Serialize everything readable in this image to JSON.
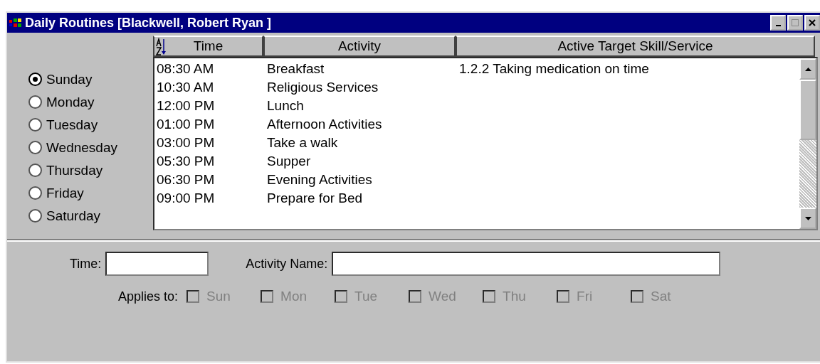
{
  "window": {
    "title": "Daily Routines [Blackwell, Robert Ryan ]"
  },
  "days": [
    {
      "label": "Sunday",
      "selected": true
    },
    {
      "label": "Monday",
      "selected": false
    },
    {
      "label": "Tuesday",
      "selected": false
    },
    {
      "label": "Wednesday",
      "selected": false
    },
    {
      "label": "Thursday",
      "selected": false
    },
    {
      "label": "Friday",
      "selected": false
    },
    {
      "label": "Saturday",
      "selected": false
    }
  ],
  "table": {
    "columns": [
      "Time",
      "Activity",
      "Active Target Skill/Service"
    ],
    "rows": [
      [
        "08:30 AM",
        "Breakfast",
        "1.2.2  Taking medication on time"
      ],
      [
        "10:30 AM",
        "Religious Services",
        ""
      ],
      [
        "12:00 PM",
        "Lunch",
        ""
      ],
      [
        "01:00 PM",
        "Afternoon Activities",
        ""
      ],
      [
        "03:00 PM",
        "Take a walk",
        ""
      ],
      [
        "05:30 PM",
        "Supper",
        ""
      ],
      [
        "06:30 PM",
        "Evening Activities",
        ""
      ],
      [
        "09:00 PM",
        "Prepare for Bed",
        ""
      ]
    ]
  },
  "form": {
    "time_label": "Time:",
    "activity_label": "Activity Name:",
    "applies_label": "Applies to:",
    "applies": [
      {
        "label": "Sun",
        "checked": false,
        "disabled": true
      },
      {
        "label": "Mon",
        "checked": false,
        "disabled": true
      },
      {
        "label": "Tue",
        "checked": false,
        "disabled": true
      },
      {
        "label": "Wed",
        "checked": false,
        "disabled": true
      },
      {
        "label": "Thu",
        "checked": false,
        "disabled": true
      },
      {
        "label": "Fri",
        "checked": false,
        "disabled": true
      },
      {
        "label": "Sat",
        "checked": false,
        "disabled": true
      }
    ]
  }
}
